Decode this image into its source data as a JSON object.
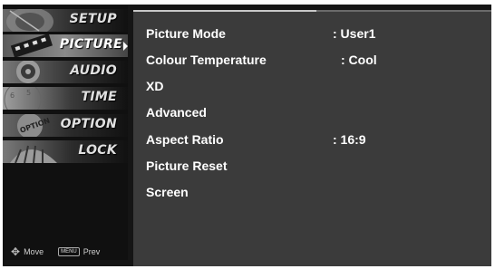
{
  "sidebar": {
    "items": [
      {
        "label": "SETUP",
        "icon": "satellite-dish-icon",
        "active": false
      },
      {
        "label": "PICTURE",
        "icon": "film-strip-icon",
        "active": true
      },
      {
        "label": "AUDIO",
        "icon": "speaker-icon",
        "active": false
      },
      {
        "label": "TIME",
        "icon": "clock-icon",
        "active": false
      },
      {
        "label": "OPTION",
        "icon": "option-tag-icon",
        "active": false
      },
      {
        "label": "LOCK",
        "icon": "lock-icon",
        "active": false
      }
    ],
    "hints": {
      "move_icon": "✥",
      "move_label": "Move",
      "menu_key": "MENU",
      "prev_label": "Prev"
    }
  },
  "main": {
    "rows": [
      {
        "name": "Picture Mode",
        "value": ": User1"
      },
      {
        "name": "Colour Temperature",
        "value": ": Cool"
      },
      {
        "name": "XD",
        "value": ""
      },
      {
        "name": "Advanced",
        "value": ""
      },
      {
        "name": "Aspect Ratio",
        "value": ": 16:9"
      },
      {
        "name": "Picture Reset",
        "value": ""
      },
      {
        "name": "Screen",
        "value": ""
      }
    ]
  },
  "colors": {
    "background": "#151515",
    "panel": "#3b3b3b",
    "text": "#ffffff"
  }
}
